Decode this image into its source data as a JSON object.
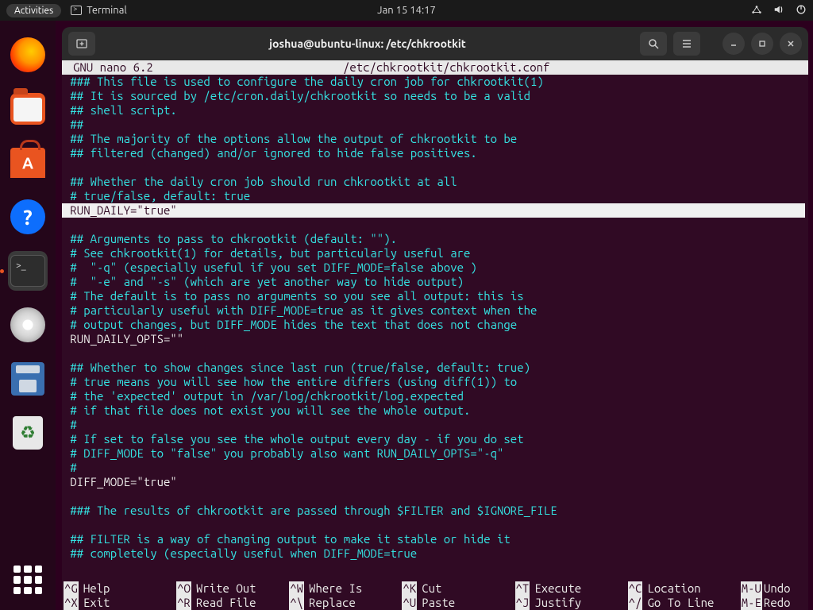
{
  "topbar": {
    "activities": "Activities",
    "app_indicator": "Terminal",
    "clock": "Jan 15  14:17"
  },
  "window": {
    "title": "joshua@ubuntu-linux: /etc/chkrootkit"
  },
  "nano": {
    "program": "GNU  nano  6.2",
    "filename": "/etc/chkrootkit/chkrootkit.conf"
  },
  "file_lines": [
    {
      "t": "comment",
      "v": "### This file is used to configure the daily cron job for chkrootkit(1)"
    },
    {
      "t": "comment",
      "v": "## It is sourced by /etc/cron.daily/chkrootkit so needs to be a valid"
    },
    {
      "t": "comment",
      "v": "## shell script."
    },
    {
      "t": "comment",
      "v": "##"
    },
    {
      "t": "comment",
      "v": "## The majority of the options allow the output of chkrootkit to be"
    },
    {
      "t": "comment",
      "v": "## filtered (changed) and/or ignored to hide false positives."
    },
    {
      "t": "blank",
      "v": ""
    },
    {
      "t": "comment",
      "v": "## Whether the daily cron job should run chkrootkit at all"
    },
    {
      "t": "comment",
      "v": "# true/false, default: true"
    },
    {
      "t": "cursor",
      "v": "RUN_DAILY=\"true\""
    },
    {
      "t": "blank",
      "v": ""
    },
    {
      "t": "comment",
      "v": "## Arguments to pass to chkrootkit (default: \"\")."
    },
    {
      "t": "comment",
      "v": "# See chkrootkit(1) for details, but particularly useful are"
    },
    {
      "t": "comment",
      "v": "#  \"-q\" (especially useful if you set DIFF_MODE=false above )"
    },
    {
      "t": "comment",
      "v": "#  \"-e\" and \"-s\" (which are yet another way to hide output)"
    },
    {
      "t": "comment",
      "v": "# The default is to pass no arguments so you see all output: this is"
    },
    {
      "t": "comment",
      "v": "# particularly useful with DIFF_MODE=true as it gives context when the"
    },
    {
      "t": "comment",
      "v": "# output changes, but DIFF_MODE hides the text that does not change"
    },
    {
      "t": "code",
      "v": "RUN_DAILY_OPTS=\"\""
    },
    {
      "t": "blank",
      "v": ""
    },
    {
      "t": "comment",
      "v": "## Whether to show changes since last run (true/false, default: true)"
    },
    {
      "t": "comment",
      "v": "# true means you will see how the entire differs (using diff(1)) to"
    },
    {
      "t": "comment",
      "v": "# the 'expected' output in /var/log/chkrootkit/log.expected"
    },
    {
      "t": "comment",
      "v": "# if that file does not exist you will see the whole output."
    },
    {
      "t": "comment",
      "v": "#"
    },
    {
      "t": "comment",
      "v": "# If set to false you see the whole output every day - if you do set"
    },
    {
      "t": "comment",
      "v": "# DIFF_MODE to \"false\" you probably also want RUN_DAILY_OPTS=\"-q\""
    },
    {
      "t": "comment",
      "v": "#"
    },
    {
      "t": "code",
      "v": "DIFF_MODE=\"true\""
    },
    {
      "t": "blank",
      "v": ""
    },
    {
      "t": "comment",
      "v": "### The results of chkrootkit are passed through $FILTER and $IGNORE_FILE"
    },
    {
      "t": "blank",
      "v": ""
    },
    {
      "t": "comment",
      "v": "## FILTER is a way of changing output to make it stable or hide it"
    },
    {
      "t": "comment",
      "v": "## completely (especially useful when DIFF_MODE=true"
    }
  ],
  "shortcuts_row1": [
    {
      "k": "^G",
      "l": "Help"
    },
    {
      "k": "^O",
      "l": "Write Out"
    },
    {
      "k": "^W",
      "l": "Where Is"
    },
    {
      "k": "^K",
      "l": "Cut"
    },
    {
      "k": "^T",
      "l": "Execute"
    },
    {
      "k": "^C",
      "l": "Location"
    },
    {
      "k": "M-U",
      "l": "Undo"
    }
  ],
  "shortcuts_row2": [
    {
      "k": "^X",
      "l": "Exit"
    },
    {
      "k": "^R",
      "l": "Read File"
    },
    {
      "k": "^\\",
      "l": "Replace"
    },
    {
      "k": "^U",
      "l": "Paste"
    },
    {
      "k": "^J",
      "l": "Justify"
    },
    {
      "k": "^/",
      "l": "Go To Line"
    },
    {
      "k": "M-E",
      "l": "Redo"
    }
  ]
}
